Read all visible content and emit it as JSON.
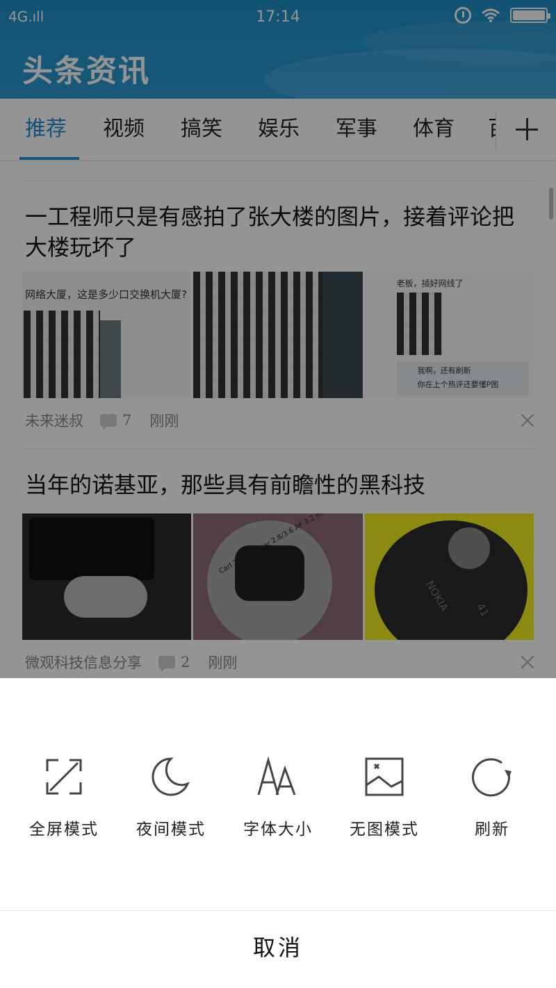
{
  "status_bar": {
    "signal": "4G.ıll",
    "time": "17:14"
  },
  "app": {
    "title": "头条资讯"
  },
  "tabs": [
    {
      "label": "推荐",
      "active": true
    },
    {
      "label": "视频"
    },
    {
      "label": "搞笑"
    },
    {
      "label": "娱乐"
    },
    {
      "label": "军事"
    },
    {
      "label": "体育"
    },
    {
      "label": "百"
    }
  ],
  "articles": [
    {
      "title": "一工程师只是有感拍了张大楼的图片，接着评论把大楼玩坏了",
      "thumb_texts": [
        "网络大厦，这是多少口交换机大厦?",
        "老板，插好网线了",
        "我啊，还有刷新",
        "你在上个热评还要懂P图"
      ],
      "source": "未来迷叔",
      "comments": "7",
      "time": "刚刚"
    },
    {
      "title": "当年的诺基亚，那些具有前瞻性的黑科技",
      "thumb_texts": [
        "Carl Zeiss Tessar 2.8/3.6 AF 3.2 megapixel",
        "NOKIA",
        "41"
      ],
      "source": "微观科技信息分享",
      "comments": "2",
      "time": "刚刚"
    }
  ],
  "sheet": {
    "actions": [
      {
        "label": "全屏模式",
        "icon": "fullscreen-icon"
      },
      {
        "label": "夜间模式",
        "icon": "moon-icon"
      },
      {
        "label": "字体大小",
        "icon": "font-size-icon"
      },
      {
        "label": "无图模式",
        "icon": "no-image-icon"
      },
      {
        "label": "刷新",
        "icon": "refresh-icon"
      }
    ],
    "cancel_label": "取消"
  },
  "colors": {
    "header": "#2196d3",
    "accent": "#1e8fcf",
    "overlay": "rgba(0,0,0,0.42)"
  }
}
